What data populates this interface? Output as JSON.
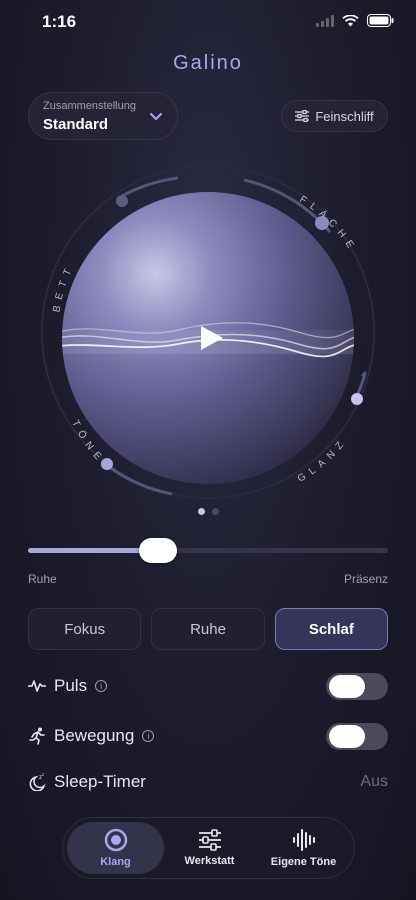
{
  "status": {
    "time": "1:16"
  },
  "app": {
    "title": "Galino"
  },
  "preset": {
    "label": "Zusammenstellung",
    "value": "Standard"
  },
  "fine_tune": {
    "label": "Feinschliff"
  },
  "orb": {
    "labels": {
      "top_left": "BETT",
      "top_right": "FLÄCHE",
      "bottom_left": "TÖNE",
      "bottom_right": "GLANZ"
    }
  },
  "pager": {
    "count": 2,
    "active": 0
  },
  "slider": {
    "low_label": "Ruhe",
    "high_label": "Präsenz",
    "value": 0.36
  },
  "modes": [
    {
      "label": "Fokus",
      "active": false
    },
    {
      "label": "Ruhe",
      "active": false
    },
    {
      "label": "Schlaf",
      "active": true
    }
  ],
  "settings": {
    "pulse": {
      "label": "Puls",
      "enabled": false
    },
    "motion": {
      "label": "Bewegung",
      "enabled": false
    },
    "sleep_timer": {
      "label": "Sleep-Timer",
      "value": "Aus"
    }
  },
  "tabs": [
    {
      "label": "Klang",
      "icon": "circle-target-icon",
      "active": true
    },
    {
      "label": "Werkstatt",
      "icon": "sliders-icon",
      "active": false
    },
    {
      "label": "Eigene Töne",
      "icon": "waveform-icon",
      "active": false
    }
  ]
}
